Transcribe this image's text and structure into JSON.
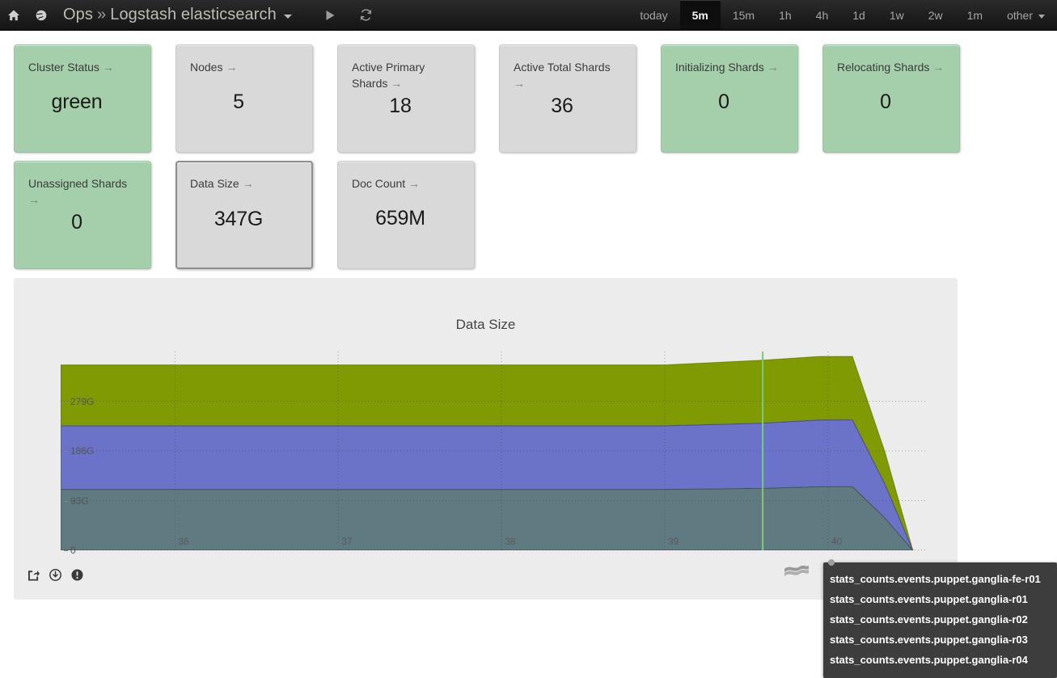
{
  "topbar": {
    "home_icon": "home-icon",
    "globe_icon": "globe-icon",
    "breadcrumb_root": "Ops",
    "breadcrumb_sep": "»",
    "breadcrumb_current": "Logstash elasticsearch",
    "play_icon": "play-icon",
    "refresh_icon": "refresh-icon",
    "time_ranges": [
      {
        "label": "today",
        "active": false
      },
      {
        "label": "5m",
        "active": true
      },
      {
        "label": "15m",
        "active": false
      },
      {
        "label": "1h",
        "active": false
      },
      {
        "label": "4h",
        "active": false
      },
      {
        "label": "1d",
        "active": false
      },
      {
        "label": "1w",
        "active": false
      },
      {
        "label": "2w",
        "active": false
      },
      {
        "label": "1m",
        "active": false
      },
      {
        "label": "other",
        "active": false,
        "has_caret": true
      }
    ]
  },
  "stats": {
    "arrow": "→",
    "row1": [
      {
        "label": "Cluster Status",
        "value": "green",
        "color": "green",
        "two_line": false,
        "selected": false
      },
      {
        "label": "Nodes",
        "value": "5",
        "color": "grey",
        "two_line": false,
        "selected": false
      },
      {
        "label": "Active Primary Shards",
        "value": "18",
        "color": "grey",
        "two_line": true,
        "selected": false
      },
      {
        "label": "Active Total Shards",
        "value": "36",
        "color": "grey",
        "two_line": true,
        "selected": false
      },
      {
        "label": "Initializing Shards",
        "value": "0",
        "color": "green",
        "two_line": false,
        "selected": false
      },
      {
        "label": "Relocating Shards",
        "value": "0",
        "color": "green",
        "two_line": false,
        "selected": false
      }
    ],
    "row2": [
      {
        "label": "Unassigned Shards",
        "value": "0",
        "color": "green",
        "two_line": true,
        "selected": false
      },
      {
        "label": "Data Size",
        "value": "347G",
        "color": "grey",
        "two_line": false,
        "selected": true
      },
      {
        "label": "Doc Count",
        "value": "659M",
        "color": "grey",
        "two_line": false,
        "selected": false
      }
    ]
  },
  "chart_panel": {
    "title": "Data Size",
    "tools": [
      {
        "name": "share-icon"
      },
      {
        "name": "download-icon"
      },
      {
        "name": "info-icon"
      }
    ],
    "type_icons": [
      {
        "name": "area-chart-icon"
      },
      {
        "name": "line-chart-icon"
      },
      {
        "name": "bar-chart-icon"
      },
      {
        "name": "scatter-chart-icon"
      },
      {
        "name": "bubble-chart-icon"
      }
    ]
  },
  "legend_tooltip": {
    "rows": [
      "stats_counts.events.puppet.ganglia-fe-r01",
      "stats_counts.events.puppet.ganglia-r01",
      "stats_counts.events.puppet.ganglia-r02",
      "stats_counts.events.puppet.ganglia-r03",
      "stats_counts.events.puppet.ganglia-r04"
    ]
  },
  "chart_data": {
    "type": "area",
    "title": "Data Size",
    "xlabel": "",
    "ylabel": "",
    "stacked": true,
    "grid": true,
    "legend_position": "bottom-right",
    "background": "#ececec",
    "ylim": [
      0,
      372
    ],
    "ytick_labels": [
      "279G",
      "186G",
      "93G",
      "0"
    ],
    "ytick_values": [
      279,
      186,
      93,
      0
    ],
    "xlim": [
      35.3,
      40.6
    ],
    "categories": [
      "36",
      "37",
      "38",
      "39",
      "40"
    ],
    "xtick_values": [
      36,
      37,
      38,
      39,
      40
    ],
    "crosshair_x": 39.6,
    "crosshair_color": "#7ec97e",
    "series": [
      {
        "name": "stats_counts.events.puppet.ganglia-r01",
        "color": "#5f7a80",
        "x": [
          35.3,
          36.0,
          37.0,
          38.0,
          39.0,
          39.6,
          39.95,
          40.15,
          40.35,
          40.52
        ],
        "values": [
          114,
          114,
          114,
          114,
          114,
          116,
          119,
          119,
          60,
          0
        ]
      },
      {
        "name": "stats_counts.events.puppet.ganglia-r02",
        "color": "#6b73c9",
        "x": [
          35.3,
          36.0,
          37.0,
          38.0,
          39.0,
          39.6,
          39.95,
          40.15,
          40.35,
          40.52
        ],
        "values": [
          119,
          119,
          119,
          119,
          119,
          122,
          125,
          125,
          63,
          0
        ]
      },
      {
        "name": "stats_counts.events.puppet.ganglia-r03",
        "color": "#7f9a03",
        "x": [
          35.3,
          36.0,
          37.0,
          38.0,
          39.0,
          39.6,
          39.95,
          40.15,
          40.35,
          40.52
        ],
        "values": [
          114,
          114,
          114,
          114,
          114,
          118,
          119,
          119,
          60,
          0
        ]
      }
    ]
  }
}
